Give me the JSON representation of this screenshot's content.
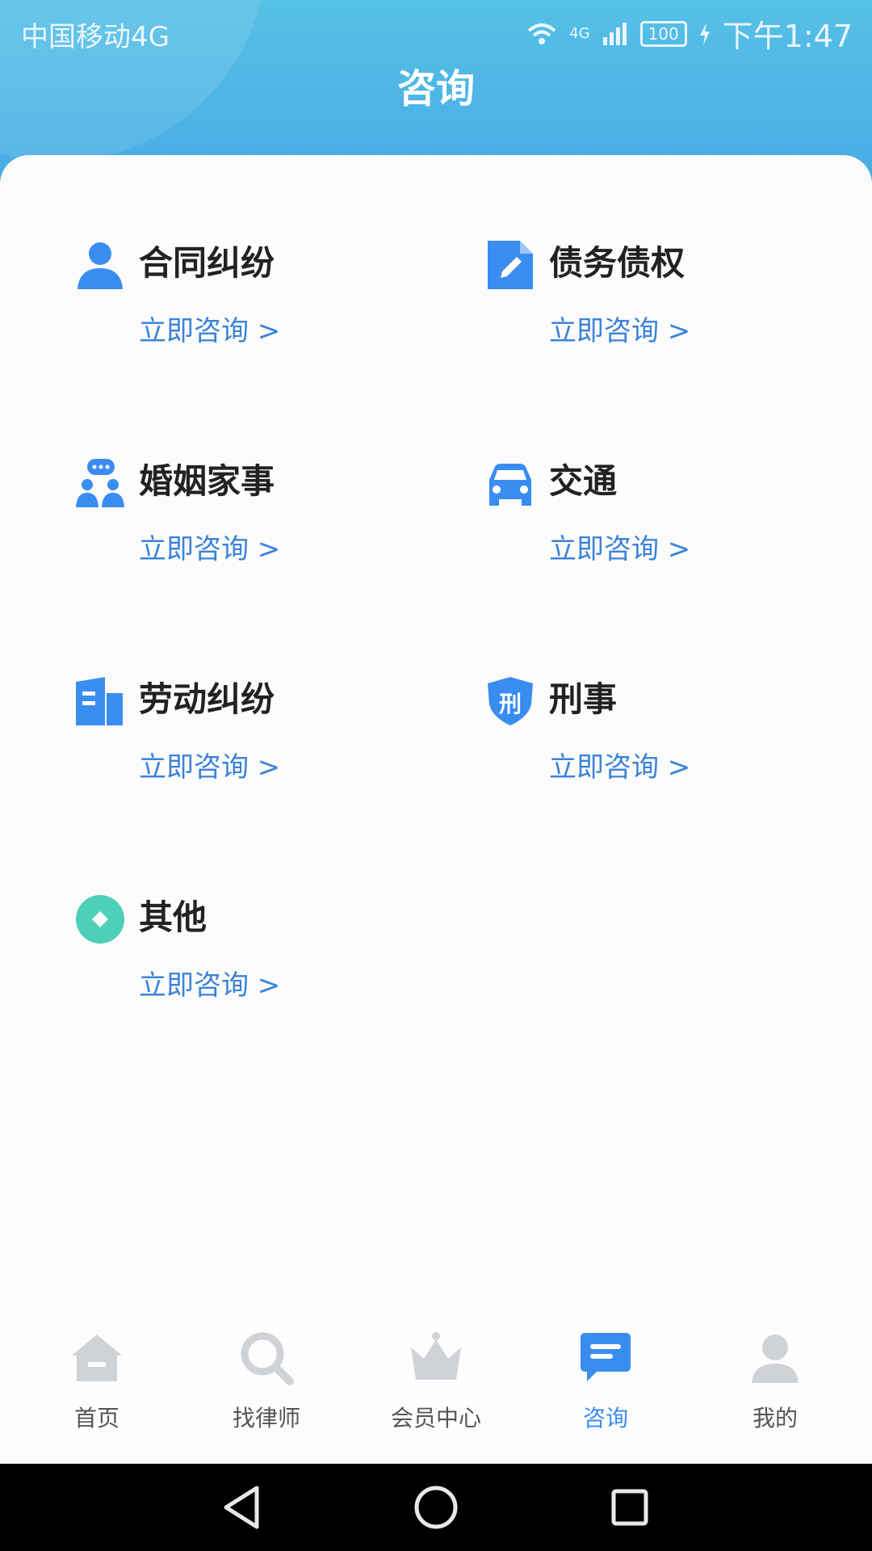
{
  "status_bar": {
    "carrier": "中国移动4G",
    "network": "4G",
    "battery": "100",
    "time": "下午1:47"
  },
  "page": {
    "title": "咨询"
  },
  "categories": [
    {
      "title": "合同纠纷",
      "cta": "立即咨询 >",
      "icon": "person-icon"
    },
    {
      "title": "债务债权",
      "cta": "立即咨询 >",
      "icon": "document-edit-icon"
    },
    {
      "title": "婚姻家事",
      "cta": "立即咨询 >",
      "icon": "couple-chat-icon"
    },
    {
      "title": "交通",
      "cta": "立即咨询 >",
      "icon": "car-icon"
    },
    {
      "title": "劳动纠纷",
      "cta": "立即咨询 >",
      "icon": "building-icon"
    },
    {
      "title": "刑事",
      "cta": "立即咨询 >",
      "icon": "shield-icon"
    },
    {
      "title": "其他",
      "cta": "立即咨询 >",
      "icon": "circle-diamond-icon"
    }
  ],
  "shield_glyph": "刑",
  "tabs": [
    {
      "label": "首页",
      "icon": "home-icon",
      "active": false
    },
    {
      "label": "找律师",
      "icon": "search-icon",
      "active": false
    },
    {
      "label": "会员中心",
      "icon": "crown-icon",
      "active": false
    },
    {
      "label": "咨询",
      "icon": "chat-icon",
      "active": true
    },
    {
      "label": "我的",
      "icon": "user-icon",
      "active": false
    }
  ],
  "colors": {
    "header_top": "#56c1e6",
    "header_bottom": "#45a8e5",
    "accent_blue": "#3a8df0",
    "link_blue": "#3b83d9",
    "icon_teal": "#4ecfb8",
    "tab_inactive": "#cfd3d8"
  }
}
